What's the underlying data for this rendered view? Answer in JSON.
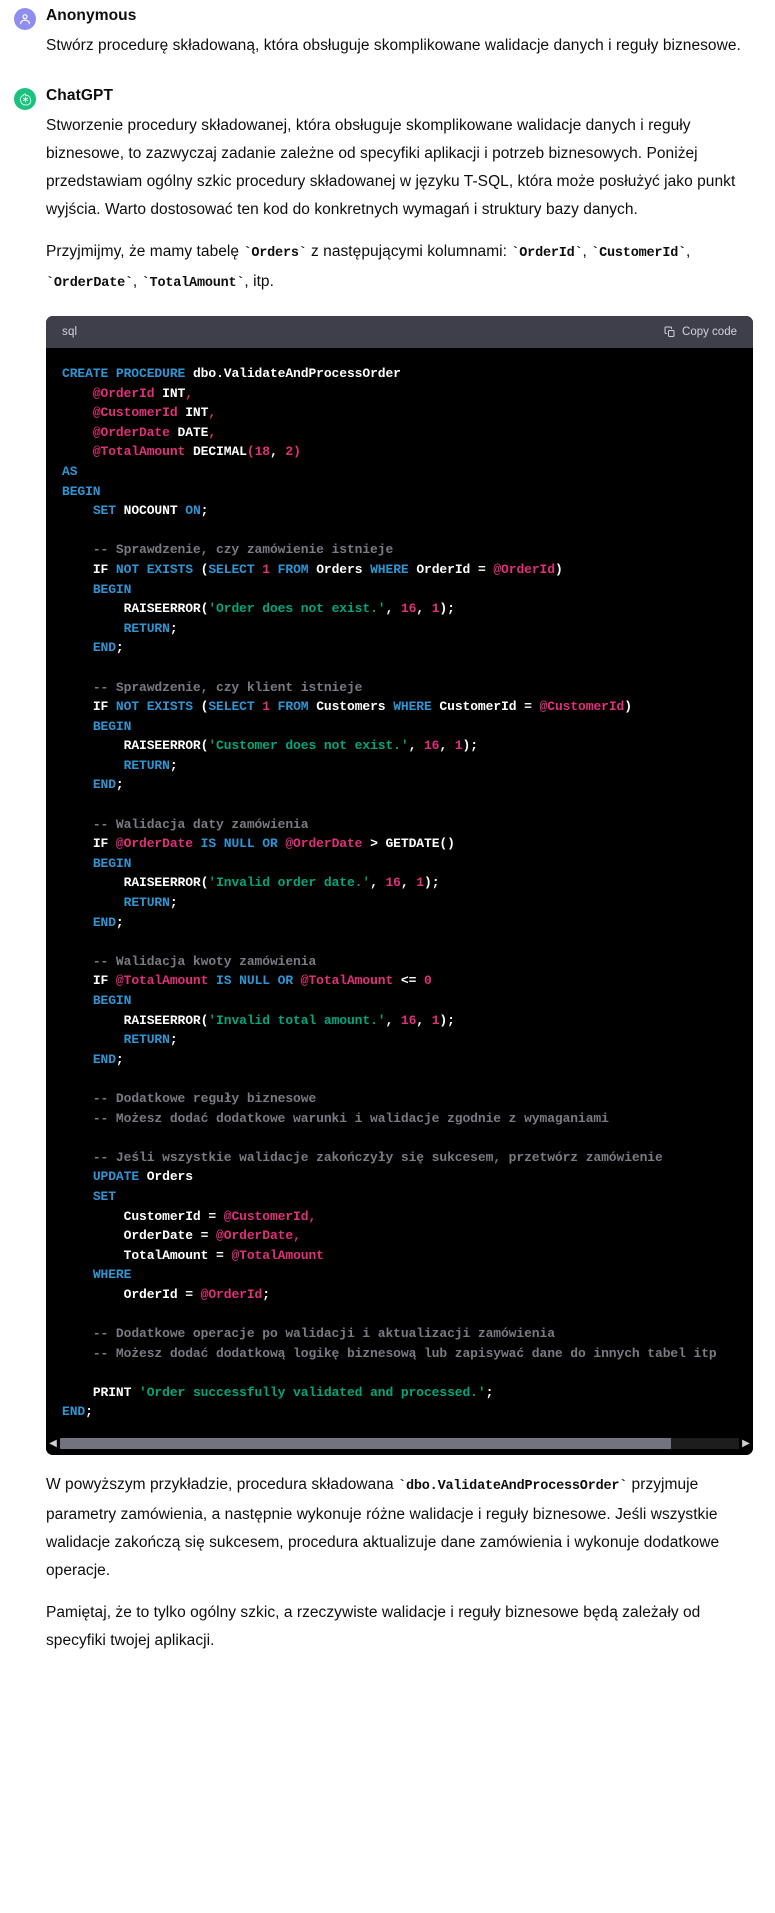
{
  "conversation": {
    "messages": [
      {
        "author": "Anonymous",
        "avatar_icon": "user-avatar-icon",
        "paragraphs": [
          "Stwórz procedurę składowaną, która obsługuje skomplikowane walidacje danych i reguły biznesowe."
        ]
      },
      {
        "author": "ChatGPT",
        "avatar_icon": "openai-logo-icon",
        "paragraphs": [
          "Stworzenie procedury składowanej, która obsługuje skomplikowane walidacje danych i reguły biznesowe, to zazwyczaj zadanie zależne od specyfiki aplikacji i potrzeb biznesowych. Poniżej przedstawiam ogólny szkic procedury składowanej w języku T-SQL, która może posłużyć jako punkt wyjścia. Warto dostosować ten kod do konkretnych wymagań i struktury bazy danych."
        ]
      }
    ]
  },
  "assumption_paragraph": {
    "part1": "Przyjmijmy, że mamy tabelę ",
    "code1": "`Orders`",
    "part2": " z następującymi kolumnami: ",
    "code2": "`OrderId`",
    "part3": ", ",
    "code3": "`CustomerId`",
    "part4": ", ",
    "code4": "`OrderDate`",
    "part5": ", ",
    "code5": "`TotalAmount`",
    "part6": ", itp."
  },
  "codeblock": {
    "language": "sql",
    "copy_label": "Copy code",
    "copy_icon": "clipboard-icon",
    "scrollbar_left_icon": "chevron-left-icon",
    "scrollbar_right_icon": "chevron-right-icon",
    "colors": {
      "keyword": "#2e95d3",
      "variable": "#df3079",
      "string": "#00a67d",
      "comment": "#7a7a84",
      "plain": "#ffffff",
      "header_bg": "#3e3f4b",
      "body_bg": "#000000"
    },
    "code_html": "<span class=\"k\">CREATE PROCEDURE</span> <span class=\"p\">dbo.ValidateAndProcessOrder</span>\n    <span class=\"v\">@OrderId</span> <span class=\"p\">INT</span><span class=\"v\">,</span>\n    <span class=\"v\">@CustomerId</span> <span class=\"p\">INT</span><span class=\"v\">,</span>\n    <span class=\"v\">@OrderDate</span> <span class=\"p\">DATE</span><span class=\"v\">,</span>\n    <span class=\"v\">@TotalAmount</span> <span class=\"p\">DECIMAL</span><span class=\"v\">(</span><span class=\"v\">18</span><span class=\"p\">, </span><span class=\"v\">2</span><span class=\"v\">)</span>\n<span class=\"k\">AS</span>\n<span class=\"k\">BEGIN</span>\n    <span class=\"k\">SET</span> <span class=\"p\">NOCOUNT</span> <span class=\"k\">ON</span><span class=\"p\">;</span>\n\n    <span class=\"c\">-- Sprawdzenie, czy zamówienie istnieje</span>\n    <span class=\"p\">IF</span> <span class=\"k\">NOT EXISTS</span> <span class=\"p\">(</span><span class=\"k\">SELECT</span> <span class=\"v\">1</span> <span class=\"k\">FROM</span> <span class=\"p\">Orders</span> <span class=\"k\">WHERE</span> <span class=\"p\">OrderId = </span><span class=\"v\">@OrderId</span><span class=\"p\">)</span>\n    <span class=\"k\">BEGIN</span>\n        <span class=\"p\">RAISEERROR(</span><span class=\"s\">'Order does not exist.'</span><span class=\"p\">, </span><span class=\"v\">16</span><span class=\"p\">, </span><span class=\"v\">1</span><span class=\"p\">);</span>\n        <span class=\"k\">RETURN</span><span class=\"p\">;</span>\n    <span class=\"k\">END</span><span class=\"p\">;</span>\n\n    <span class=\"c\">-- Sprawdzenie, czy klient istnieje</span>\n    <span class=\"p\">IF</span> <span class=\"k\">NOT EXISTS</span> <span class=\"p\">(</span><span class=\"k\">SELECT</span> <span class=\"v\">1</span> <span class=\"k\">FROM</span> <span class=\"p\">Customers</span> <span class=\"k\">WHERE</span> <span class=\"p\">CustomerId = </span><span class=\"v\">@CustomerId</span><span class=\"p\">)</span>\n    <span class=\"k\">BEGIN</span>\n        <span class=\"p\">RAISEERROR(</span><span class=\"s\">'Customer does not exist.'</span><span class=\"p\">, </span><span class=\"v\">16</span><span class=\"p\">, </span><span class=\"v\">1</span><span class=\"p\">);</span>\n        <span class=\"k\">RETURN</span><span class=\"p\">;</span>\n    <span class=\"k\">END</span><span class=\"p\">;</span>\n\n    <span class=\"c\">-- Walidacja daty zamówienia</span>\n    <span class=\"p\">IF</span> <span class=\"v\">@OrderDate</span> <span class=\"k\">IS NULL OR</span> <span class=\"v\">@OrderDate</span> <span class=\"p\">&gt; GETDATE()</span>\n    <span class=\"k\">BEGIN</span>\n        <span class=\"p\">RAISEERROR(</span><span class=\"s\">'Invalid order date.'</span><span class=\"p\">, </span><span class=\"v\">16</span><span class=\"p\">, </span><span class=\"v\">1</span><span class=\"p\">);</span>\n        <span class=\"k\">RETURN</span><span class=\"p\">;</span>\n    <span class=\"k\">END</span><span class=\"p\">;</span>\n\n    <span class=\"c\">-- Walidacja kwoty zamówienia</span>\n    <span class=\"p\">IF</span> <span class=\"v\">@TotalAmount</span> <span class=\"k\">IS NULL OR</span> <span class=\"v\">@TotalAmount</span> <span class=\"p\">&lt;= </span><span class=\"v\">0</span>\n    <span class=\"k\">BEGIN</span>\n        <span class=\"p\">RAISEERROR(</span><span class=\"s\">'Invalid total amount.'</span><span class=\"p\">, </span><span class=\"v\">16</span><span class=\"p\">, </span><span class=\"v\">1</span><span class=\"p\">);</span>\n        <span class=\"k\">RETURN</span><span class=\"p\">;</span>\n    <span class=\"k\">END</span><span class=\"p\">;</span>\n\n    <span class=\"c\">-- Dodatkowe reguły biznesowe</span>\n    <span class=\"c\">-- Możesz dodać dodatkowe warunki i walidacje zgodnie z wymaganiami</span>\n\n    <span class=\"c\">-- Jeśli wszystkie walidacje zakończyły się sukcesem, przetwórz zamówienie</span>\n    <span class=\"k\">UPDATE</span> <span class=\"p\">Orders</span>\n    <span class=\"k\">SET</span>\n        <span class=\"p\">CustomerId = </span><span class=\"v\">@CustomerId</span><span class=\"v\">,</span>\n        <span class=\"p\">OrderDate = </span><span class=\"v\">@OrderDate</span><span class=\"v\">,</span>\n        <span class=\"p\">TotalAmount = </span><span class=\"v\">@TotalAmount</span>\n    <span class=\"k\">WHERE</span>\n        <span class=\"p\">OrderId = </span><span class=\"v\">@OrderId</span><span class=\"p\">;</span>\n\n    <span class=\"c\">-- Dodatkowe operacje po walidacji i aktualizacji zamówienia</span>\n    <span class=\"c\">-- Możesz dodać dodatkową logikę biznesową lub zapisywać dane do innych tabel itp</span>\n\n    <span class=\"p\">PRINT </span><span class=\"s\">'Order successfully validated and processed.'</span><span class=\"p\">;</span>\n<span class=\"k\">END</span><span class=\"p\">;</span>"
  },
  "closing": {
    "p1_part1": "W powyższym przykładzie, procedura składowana ",
    "p1_code": "`dbo.ValidateAndProcessOrder`",
    "p1_part2": " przyjmuje parametry zamówienia, a następnie wykonuje różne walidacje i reguły biznesowe. Jeśli wszystkie walidacje zakończą się sukcesem, procedura aktualizuje dane zamówienia i wykonuje dodatkowe operacje.",
    "p2": "Pamiętaj, że to tylko ogólny szkic, a rzeczywiste walidacje i reguły biznesowe będą zależały od specyfiki twojej aplikacji."
  }
}
